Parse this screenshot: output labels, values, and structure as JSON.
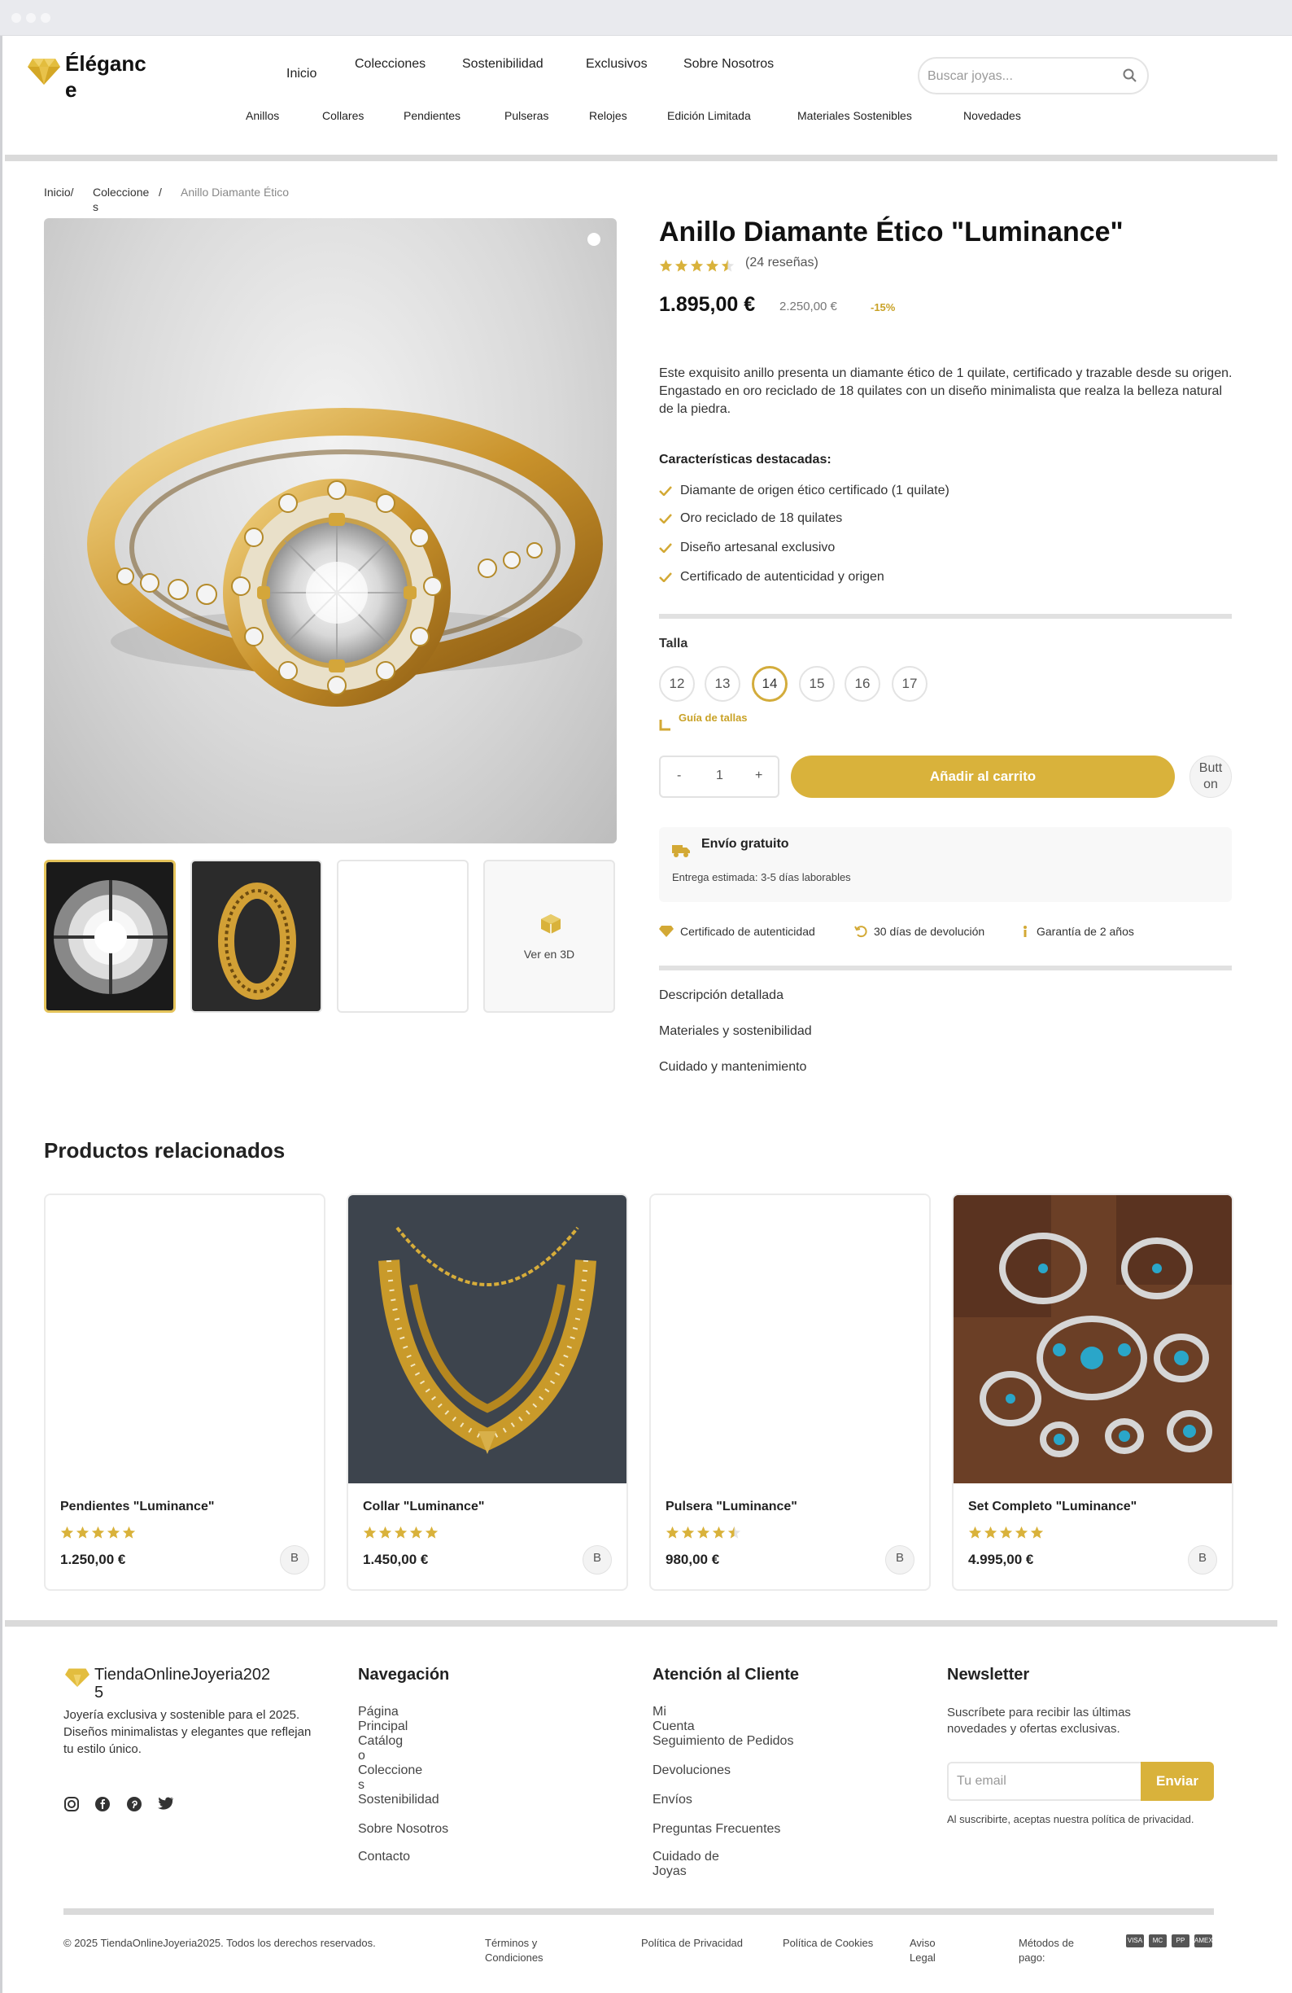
{
  "brand": {
    "logo_text": "Éléganc",
    "logo_text2": "e"
  },
  "nav": {
    "items": [
      "Inicio",
      "Colecciones",
      "Sostenibilidad",
      "Exclusivos",
      "Sobre Nosotros"
    ]
  },
  "categories": [
    "Anillos",
    "Collares",
    "Pendientes",
    "Pulseras",
    "Relojes",
    "Edición Limitada",
    "Materiales Sostenibles",
    "Novedades"
  ],
  "search": {
    "placeholder": "Buscar joyas..."
  },
  "breadcrumb": {
    "home": "Inicio/",
    "collections": "Coleccione",
    "collections2": "s",
    "sep": "/",
    "current": "Anillo Diamante Ético"
  },
  "gallery": {
    "view3d_label": "Ver en 3D"
  },
  "product": {
    "title": "Anillo Diamante Ético \"Luminance\"",
    "rating": 4.5,
    "reviews": "(24 reseñas)",
    "price": "1.895,00 €",
    "old_price": "2.250,00 €",
    "discount": "-15%",
    "description": "Este exquisito anillo presenta un diamante ético de 1 quilate, certificado y trazable desde su origen. Engastado en oro reciclado de 18 quilates con un diseño minimalista que realza la belleza natural de la piedra.",
    "features_title": "Características destacadas:",
    "features": [
      "Diamante de origen ético certificado (1 quilate)",
      "Oro reciclado de 18 quilates",
      "Diseño artesanal exclusivo",
      "Certificado de autenticidad y origen"
    ],
    "size_label": "Talla",
    "sizes": [
      "12",
      "13",
      "14",
      "15",
      "16",
      "17"
    ],
    "selected_size": "14",
    "size_guide": "Guía de tallas",
    "qty_minus": "-",
    "qty_value": "1",
    "qty_plus": "+",
    "add_to_cart": "Añadir al carrito",
    "extra_button_1": "Butt",
    "extra_button_2": "on",
    "shipping_title": "Envío gratuito",
    "shipping_text": "Entrega estimada: 3-5 días laborables",
    "guarantees": [
      "Certificado de autenticidad",
      "30 días de devolución",
      "Garantía de 2 años"
    ],
    "accordion": [
      "Descripción detallada",
      "Materiales y sostenibilidad",
      "Cuidado y mantenimiento"
    ]
  },
  "related": {
    "title": "Productos relacionados",
    "items": [
      {
        "name": "Pendientes \"Luminance\"",
        "price": "1.250,00 €",
        "rating": 5,
        "button": "B"
      },
      {
        "name": "Collar \"Luminance\"",
        "price": "1.450,00 €",
        "rating": 5,
        "button": "B"
      },
      {
        "name": "Pulsera \"Luminance\"",
        "price": "980,00 €",
        "rating": 4.5,
        "button": "B"
      },
      {
        "name": "Set Completo \"Luminance\"",
        "price": "4.995,00 €",
        "rating": 5,
        "button": "B"
      }
    ]
  },
  "footer": {
    "brand1": "TiendaOnlineJoyeria202",
    "brand2": "5",
    "about": "Joyería exclusiva y sostenible para el 2025. Diseños minimalistas y elegantes que reflejan tu estilo único.",
    "nav_title": "Navegación",
    "nav_links": [
      "Página",
      "Principal",
      "Catálog",
      "o",
      "Coleccione",
      "s",
      "Sostenibilidad",
      "Sobre Nosotros",
      "Contacto"
    ],
    "care_title": "Atención al Cliente",
    "care_links": [
      "Mi",
      "Cuenta",
      "Seguimiento de Pedidos",
      "Devoluciones",
      "Envíos",
      "Preguntas Frecuentes",
      "Cuidado de",
      "Joyas"
    ],
    "newsletter_title": "Newsletter",
    "newsletter_text": "Suscríbete para recibir las últimas novedades y ofertas exclusivas.",
    "email_placeholder": "Tu email",
    "send": "Enviar",
    "privacy_note": "Al suscribirte, aceptas nuestra política de privacidad.",
    "copyright": "© 2025 TiendaOnlineJoyeria2025. Todos los derechos reservados.",
    "legal": [
      "Términos y",
      "Condiciones",
      "Política de Privacidad",
      "Política de Cookies",
      "Aviso",
      "Legal",
      "Métodos de",
      "pago:"
    ],
    "payments": [
      "VISA",
      "MC",
      "PP",
      "AMEX"
    ]
  },
  "colors": {
    "accent": "#d9b23b",
    "text": "#222222"
  }
}
